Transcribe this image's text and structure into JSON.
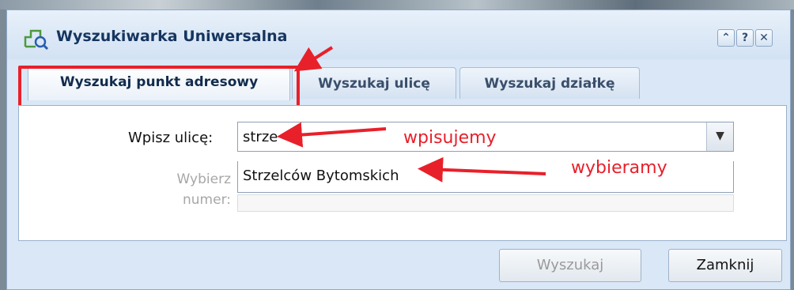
{
  "dialog": {
    "title": "Wyszukiwarka Uniwersalna",
    "tools": {
      "collapse": "⌃",
      "help": "?",
      "close": "✕"
    }
  },
  "tabs": [
    {
      "label": "Wyszukaj punkt adresowy",
      "active": true
    },
    {
      "label": "Wyszukaj ulicę",
      "active": false
    },
    {
      "label": "Wyszukaj działkę",
      "active": false
    }
  ],
  "form": {
    "street_label": "Wpisz ulicę:",
    "street_value": "strze",
    "suggestion": "Strzelców Bytomskich",
    "number_label_line1": "Wybierz",
    "number_label_line2": "numer:"
  },
  "buttons": {
    "search": "Wyszukaj",
    "close": "Zamknij"
  },
  "annotations": {
    "typing": "wpisujemy",
    "select": "wybieramy",
    "color": "#e8202a"
  },
  "icons": {
    "app": "search-map-icon",
    "dropdown": "chevron-down-icon"
  }
}
